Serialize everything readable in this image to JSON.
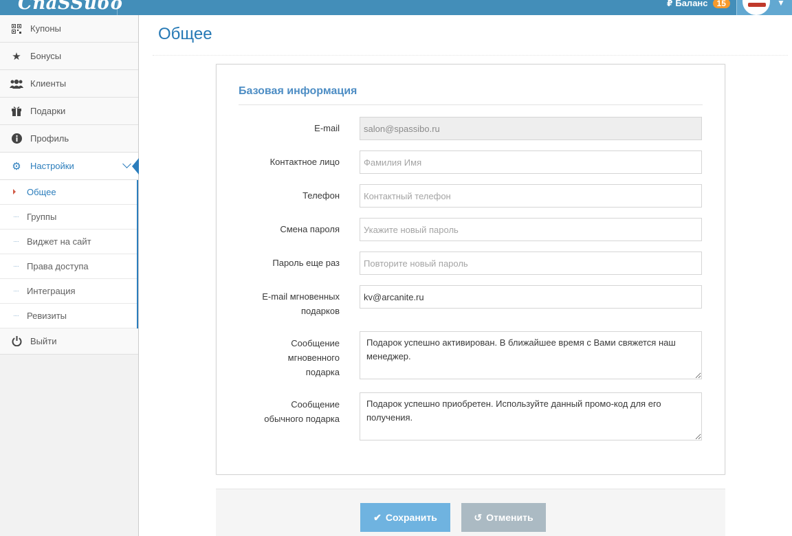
{
  "header": {
    "brand": "СпаSSибо",
    "balance_label": "Баланс",
    "balance_count": "15",
    "colors": {
      "navbar": "#438eb9",
      "accent": "#2b7dbc",
      "badge": "#f79a2c"
    }
  },
  "sidebar": {
    "items": [
      {
        "label": "Купоны",
        "icon": "qrcode-icon"
      },
      {
        "label": "Бонусы",
        "icon": "star-icon"
      },
      {
        "label": "Клиенты",
        "icon": "users-icon"
      },
      {
        "label": "Подарки",
        "icon": "gift-icon"
      },
      {
        "label": "Профиль",
        "icon": "info-icon"
      },
      {
        "label": "Настройки",
        "icon": "gear-icon"
      }
    ],
    "submenu": [
      "Общее",
      "Группы",
      "Виджет на сайт",
      "Права доступа",
      "Интеграция",
      "Ревизиты"
    ],
    "logout": "Выйти"
  },
  "main": {
    "title": "Общее",
    "section": "Базовая информация",
    "fields": {
      "email": {
        "label": "E-mail",
        "value": "salon@spassibo.ru"
      },
      "contact": {
        "label": "Контактное лицо",
        "placeholder": "Фамилия Имя"
      },
      "phone": {
        "label": "Телефон",
        "placeholder": "Контактный телефон"
      },
      "password": {
        "label": "Смена пароля",
        "placeholder": "Укажите новый пароль"
      },
      "password2": {
        "label": "Пароль еще раз",
        "placeholder": "Повторите новый пароль"
      },
      "gift_email": {
        "label1": "E-mail мгновенных",
        "label2": "подарков",
        "value": "kv@arcanite.ru"
      },
      "instant_msg": {
        "label1": "Сообщение",
        "label2": "мгновенного",
        "label3": "подарка",
        "value": "Подарок успешно активирован. В ближайшее время с Вами свяжется наш менеджер."
      },
      "regular_msg": {
        "label1": "Сообщение",
        "label2": "обычного подарка",
        "value": "Подарок успешно приобретен. Используйте данный промо-код для его получения."
      }
    },
    "buttons": {
      "save": "Сохранить",
      "cancel": "Отменить"
    }
  }
}
